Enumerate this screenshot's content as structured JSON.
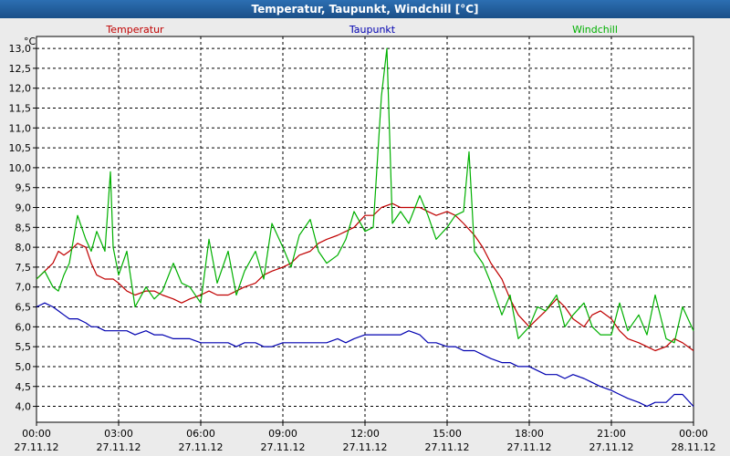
{
  "window": {
    "title": "Temperatur, Taupunkt, Windchill [°C]"
  },
  "chart_data": {
    "type": "line",
    "title": "Temperatur, Taupunkt, Windchill [°C]",
    "unit": "°C",
    "ylim": [
      3.6,
      13.3
    ],
    "y_ticks": [
      "4,0",
      "4,5",
      "5,0",
      "5,5",
      "6,0",
      "6,5",
      "7,0",
      "7,5",
      "8,0",
      "8,5",
      "9,0",
      "9,5",
      "10,0",
      "10,5",
      "11,0",
      "11,5",
      "12,0",
      "12,5",
      "13,0"
    ],
    "x_range_hours": [
      0,
      24
    ],
    "x_ticks": [
      {
        "time": "00:00",
        "date": "27.11.12"
      },
      {
        "time": "03:00",
        "date": "27.11.12"
      },
      {
        "time": "06:00",
        "date": "27.11.12"
      },
      {
        "time": "09:00",
        "date": "27.11.12"
      },
      {
        "time": "12:00",
        "date": "27.11.12"
      },
      {
        "time": "15:00",
        "date": "27.11.12"
      },
      {
        "time": "18:00",
        "date": "27.11.12"
      },
      {
        "time": "21:00",
        "date": "27.11.12"
      },
      {
        "time": "00:00",
        "date": "28.11.12"
      }
    ],
    "grid": true,
    "legend_position": "top",
    "series": [
      {
        "name": "Temperatur",
        "color": "#c00000",
        "x": [
          0,
          0.3,
          0.6,
          0.8,
          1.0,
          1.2,
          1.5,
          1.8,
          2.0,
          2.2,
          2.5,
          2.8,
          3.0,
          3.3,
          3.6,
          4.0,
          4.3,
          4.6,
          5.0,
          5.3,
          5.6,
          6.0,
          6.3,
          6.6,
          7.0,
          7.3,
          7.6,
          8.0,
          8.3,
          8.6,
          9.0,
          9.3,
          9.6,
          10.0,
          10.3,
          10.6,
          11.0,
          11.3,
          11.6,
          12.0,
          12.3,
          12.6,
          13.0,
          13.3,
          13.6,
          14.0,
          14.3,
          14.6,
          15.0,
          15.3,
          15.6,
          16.0,
          16.3,
          16.6,
          17.0,
          17.3,
          17.6,
          18.0,
          18.3,
          18.6,
          19.0,
          19.3,
          19.6,
          20.0,
          20.3,
          20.6,
          21.0,
          21.3,
          21.6,
          22.0,
          22.3,
          22.6,
          23.0,
          23.3,
          23.6,
          24.0
        ],
        "y": [
          7.2,
          7.4,
          7.6,
          7.9,
          7.8,
          7.9,
          8.1,
          8.0,
          7.6,
          7.3,
          7.2,
          7.2,
          7.1,
          6.9,
          6.8,
          6.9,
          6.9,
          6.8,
          6.7,
          6.6,
          6.7,
          6.8,
          6.9,
          6.8,
          6.8,
          6.9,
          7.0,
          7.1,
          7.3,
          7.4,
          7.5,
          7.6,
          7.8,
          7.9,
          8.1,
          8.2,
          8.3,
          8.4,
          8.5,
          8.8,
          8.8,
          9.0,
          9.1,
          9.0,
          9.0,
          9.0,
          8.9,
          8.8,
          8.9,
          8.8,
          8.6,
          8.3,
          8.0,
          7.6,
          7.2,
          6.7,
          6.3,
          6.0,
          6.2,
          6.4,
          6.7,
          6.5,
          6.2,
          6.0,
          6.3,
          6.4,
          6.2,
          5.9,
          5.7,
          5.6,
          5.5,
          5.4,
          5.5,
          5.7,
          5.6,
          5.4
        ]
      },
      {
        "name": "Taupunkt",
        "color": "#0000b0",
        "x": [
          0,
          0.3,
          0.6,
          0.8,
          1.0,
          1.2,
          1.5,
          1.8,
          2.0,
          2.2,
          2.5,
          2.8,
          3.0,
          3.3,
          3.6,
          4.0,
          4.3,
          4.6,
          5.0,
          5.3,
          5.6,
          6.0,
          6.3,
          6.6,
          7.0,
          7.3,
          7.6,
          8.0,
          8.3,
          8.6,
          9.0,
          9.3,
          9.6,
          10.0,
          10.3,
          10.6,
          11.0,
          11.3,
          11.6,
          12.0,
          12.3,
          12.6,
          13.0,
          13.3,
          13.6,
          14.0,
          14.3,
          14.6,
          15.0,
          15.3,
          15.6,
          16.0,
          16.3,
          16.6,
          17.0,
          17.3,
          17.6,
          18.0,
          18.3,
          18.6,
          19.0,
          19.3,
          19.6,
          20.0,
          20.3,
          20.6,
          21.0,
          21.3,
          21.6,
          22.0,
          22.3,
          22.6,
          23.0,
          23.3,
          23.6,
          24.0
        ],
        "y": [
          6.5,
          6.6,
          6.5,
          6.4,
          6.3,
          6.2,
          6.2,
          6.1,
          6.0,
          6.0,
          5.9,
          5.9,
          5.9,
          5.9,
          5.8,
          5.9,
          5.8,
          5.8,
          5.7,
          5.7,
          5.7,
          5.6,
          5.6,
          5.6,
          5.6,
          5.5,
          5.6,
          5.6,
          5.5,
          5.5,
          5.6,
          5.6,
          5.6,
          5.6,
          5.6,
          5.6,
          5.7,
          5.6,
          5.7,
          5.8,
          5.8,
          5.8,
          5.8,
          5.8,
          5.9,
          5.8,
          5.6,
          5.6,
          5.5,
          5.5,
          5.4,
          5.4,
          5.3,
          5.2,
          5.1,
          5.1,
          5.0,
          5.0,
          4.9,
          4.8,
          4.8,
          4.7,
          4.8,
          4.7,
          4.6,
          4.5,
          4.4,
          4.3,
          4.2,
          4.1,
          4.0,
          4.1,
          4.1,
          4.3,
          4.3,
          4.0
        ]
      },
      {
        "name": "Windchill",
        "color": "#00b000",
        "x": [
          0,
          0.3,
          0.6,
          0.8,
          1.0,
          1.2,
          1.5,
          1.8,
          2.0,
          2.2,
          2.5,
          2.7,
          2.8,
          3.0,
          3.3,
          3.6,
          4.0,
          4.3,
          4.6,
          5.0,
          5.3,
          5.6,
          6.0,
          6.3,
          6.6,
          7.0,
          7.3,
          7.6,
          8.0,
          8.3,
          8.6,
          9.0,
          9.3,
          9.6,
          10.0,
          10.3,
          10.6,
          11.0,
          11.3,
          11.6,
          12.0,
          12.3,
          12.6,
          12.8,
          13.0,
          13.3,
          13.6,
          14.0,
          14.3,
          14.6,
          15.0,
          15.3,
          15.6,
          15.8,
          16.0,
          16.3,
          16.6,
          17.0,
          17.3,
          17.6,
          18.0,
          18.3,
          18.6,
          19.0,
          19.3,
          19.6,
          20.0,
          20.3,
          20.6,
          21.0,
          21.3,
          21.6,
          22.0,
          22.3,
          22.6,
          23.0,
          23.3,
          23.6,
          24.0
        ],
        "y": [
          7.2,
          7.4,
          7.0,
          6.9,
          7.3,
          7.6,
          8.8,
          8.2,
          7.9,
          8.4,
          7.9,
          9.9,
          8.0,
          7.3,
          7.9,
          6.5,
          7.0,
          6.7,
          6.9,
          7.6,
          7.1,
          7.0,
          6.6,
          8.2,
          7.1,
          7.9,
          6.8,
          7.4,
          7.9,
          7.2,
          8.6,
          8.0,
          7.5,
          8.3,
          8.7,
          7.9,
          7.6,
          7.8,
          8.2,
          8.9,
          8.4,
          8.5,
          11.8,
          13.0,
          8.6,
          8.9,
          8.6,
          9.3,
          8.8,
          8.2,
          8.5,
          8.8,
          8.9,
          10.4,
          7.9,
          7.6,
          7.1,
          6.3,
          6.8,
          5.7,
          6.0,
          6.5,
          6.4,
          6.8,
          6.0,
          6.3,
          6.6,
          6.0,
          5.8,
          5.8,
          6.6,
          5.9,
          6.3,
          5.8,
          6.8,
          5.7,
          5.6,
          6.5,
          5.9
        ]
      }
    ]
  }
}
